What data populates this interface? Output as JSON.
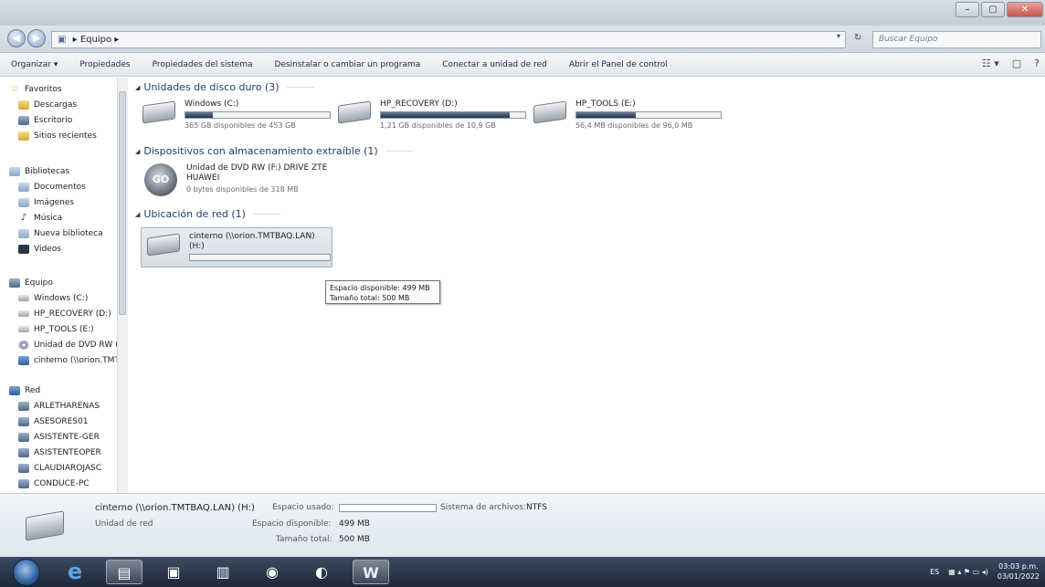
{
  "window": {
    "buttons": {
      "minimize": "–",
      "maximize": "▢",
      "close": "✕"
    }
  },
  "address": {
    "back_glyph": "◀",
    "forward_glyph": "▶",
    "path_separator": "▸",
    "path": "Equipo",
    "dropdown_glyph": "▾",
    "refresh_glyph": "↻",
    "search_placeholder": "Buscar Equipo"
  },
  "toolbar": {
    "organize": "Organizar ▾",
    "properties": "Propiedades",
    "system_properties": "Propiedades del sistema",
    "uninstall": "Desinstalar o cambiar un programa",
    "map_drive": "Conectar a unidad de red",
    "control_panel": "Abrir el Panel de control",
    "right_icons": {
      "views": "☷ ▾",
      "preview": "▢",
      "help": "?"
    }
  },
  "nav": {
    "favorites": {
      "header": "Favoritos",
      "items": [
        "Descargas",
        "Escritorio",
        "Sitios recientes"
      ]
    },
    "libraries": {
      "header": "Bibliotecas",
      "items": [
        "Documentos",
        "Imágenes",
        "Música",
        "Nueva biblioteca",
        "Videos"
      ]
    },
    "computer": {
      "header": "Equipo",
      "items": [
        "Windows (C:)",
        "HP_RECOVERY (D:)",
        "HP_TOOLS (E:)",
        "Unidad de DVD RW (F:)",
        "cinterno (\\\\orion.TMTBAQ.LAN) (H:)"
      ]
    },
    "network": {
      "header": "Red",
      "items": [
        "ARLETHARENAS",
        "ASESORES01",
        "ASISTENTE-GER",
        "ASISTENTEOPER",
        "CLAUDIAROJASC",
        "CONDUCE-PC"
      ]
    }
  },
  "groups": {
    "hdd": "Unidades de disco duro (3)",
    "removable": "Dispositivos con almacenamiento extraíble (1)",
    "network": "Ubicación de red (1)"
  },
  "drives": [
    {
      "name": "Windows (C:)",
      "free": "365 GB disponibles de 453 GB",
      "used_fraction": 0.19
    },
    {
      "name": "HP_RECOVERY (D:)",
      "free": "1,21 GB disponibles de 10,9 GB",
      "used_fraction": 0.89
    },
    {
      "name": "HP_TOOLS (E:)",
      "free": "56,4 MB disponibles de 96,0 MB",
      "used_fraction": 0.41
    }
  ],
  "dvd": {
    "name_line1": "Unidad de DVD RW (F:) DRIVE ZTE",
    "name_line2": "HUAWEI",
    "free": "0 bytes disponibles de 318 MB",
    "icon_text": "GO"
  },
  "network_drive": {
    "name": "cinterno (\\\\orion.TMTBAQ.LAN)",
    "letter": "(H:)",
    "used_fraction": 0.002
  },
  "tooltip": {
    "line1": "Espacio disponible: 499 MB",
    "line2": "Tamaño total: 500 MB"
  },
  "details": {
    "name": "cinterno (\\\\orion.TMTBAQ.LAN) (H:)",
    "type": "Unidad de red",
    "used_label": "Espacio usado:",
    "free_label": "Espacio disponible:",
    "free_value": "499 MB",
    "total_label": "Tamaño total:",
    "total_value": "500 MB",
    "fs_label": "Sistema de archivos:",
    "fs_value": "NTFS"
  },
  "taskbar": {
    "apps": [
      "e",
      "▤",
      "▣",
      "▥",
      "◉",
      "◐",
      "W"
    ],
    "tray": {
      "lang": "ES",
      "icons": "▦ ▴ ⚑ ▭ ◂)"
    },
    "time": "03:03 p.m.",
    "date": "03/01/2022"
  }
}
